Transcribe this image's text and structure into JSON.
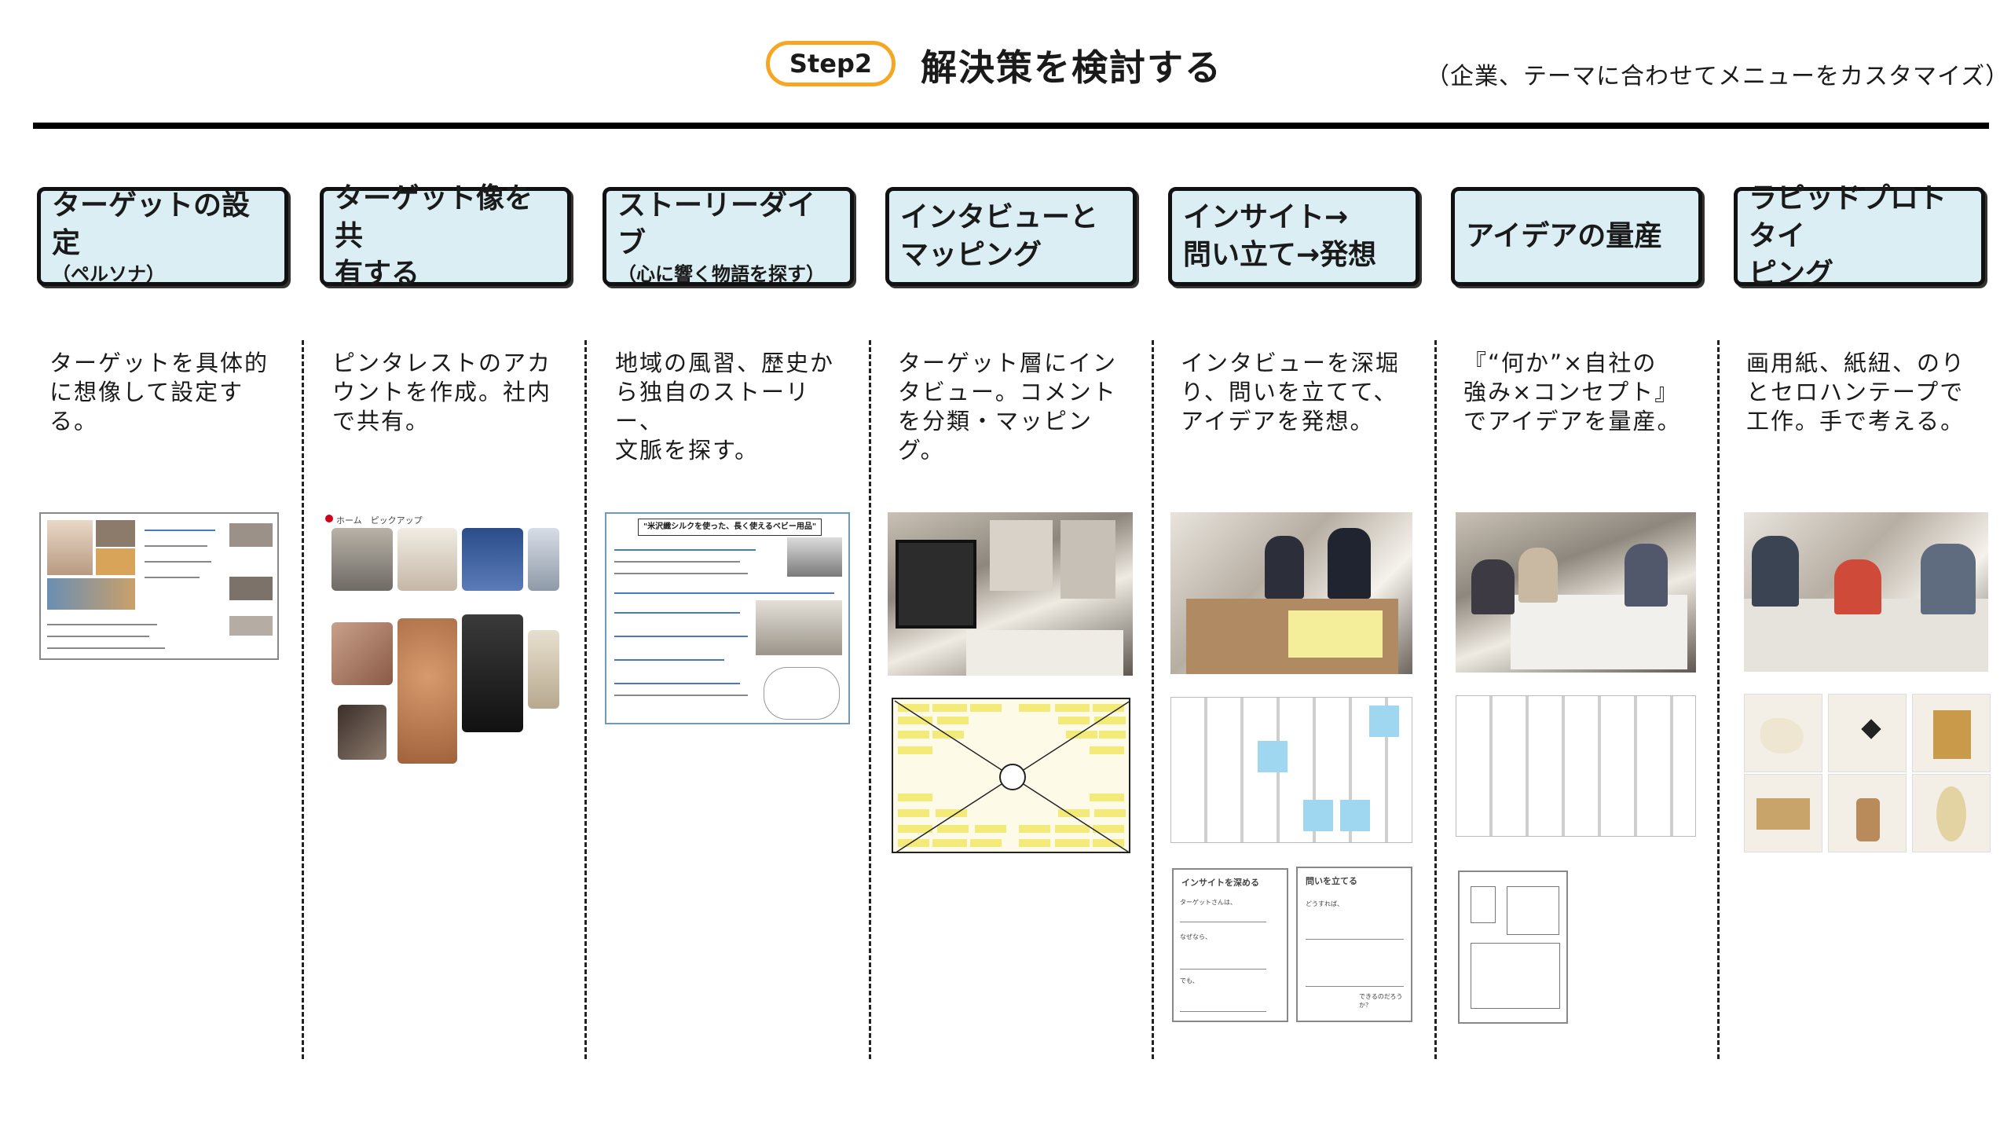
{
  "header": {
    "step_label": "Step2",
    "title": "解決策を検討する",
    "note": "（企業、テーマに合わせてメニューをカスタマイズ）"
  },
  "colors": {
    "pill_border": "#f5a623",
    "box_fill": "#dbeef4",
    "box_border": "#111111"
  },
  "columns": [
    {
      "title": "ターゲットの設定",
      "subtitle": "（ペルソナ）",
      "desc": "ターゲットを具体的\nに想像して設定する。"
    },
    {
      "title": "ターゲット像を共\n有する",
      "subtitle": "",
      "desc": "ピンタレストのアカ\nウントを作成。社内\nで共有。"
    },
    {
      "title": "ストーリーダイブ",
      "subtitle": "（心に響く物語を探す）",
      "desc": "地域の風習、歴史か\nら独自のストーリー、\n文脈を探す。"
    },
    {
      "title": "インタビューと\nマッピング",
      "subtitle": "",
      "desc": "ターゲット層にイン\nタビュー。コメント\nを分類・マッピング。"
    },
    {
      "title": "インサイト→\n問い立て→発想",
      "subtitle": "",
      "desc": "インタビューを深堀\nり、問いを立てて、\nアイデアを発想。"
    },
    {
      "title": "アイデアの量産",
      "subtitle": "",
      "desc": "『“何か”×自社の\n強み×コンセプト』\nでアイデアを量産。"
    },
    {
      "title": "ラピッドプロトタイ\nピング",
      "subtitle": "",
      "desc": "画用紙、紙紐、のり\nとセロハンテープで\n工作。手で考える。"
    }
  ],
  "thumbs": {
    "pinterest_nav": "ホーム　ピックアップ",
    "story_heading": "\"米沢織シルクを使った、長く使えるベビー用品\"",
    "insight_sheet_title": "インサイトを深める",
    "question_sheet_title": "問いを立てる",
    "insight_lines": [
      "ターゲットさんは、",
      "なぜなら、",
      "でも、"
    ],
    "question_lines": [
      "どうすれば、",
      "できるのだろうか？"
    ]
  }
}
